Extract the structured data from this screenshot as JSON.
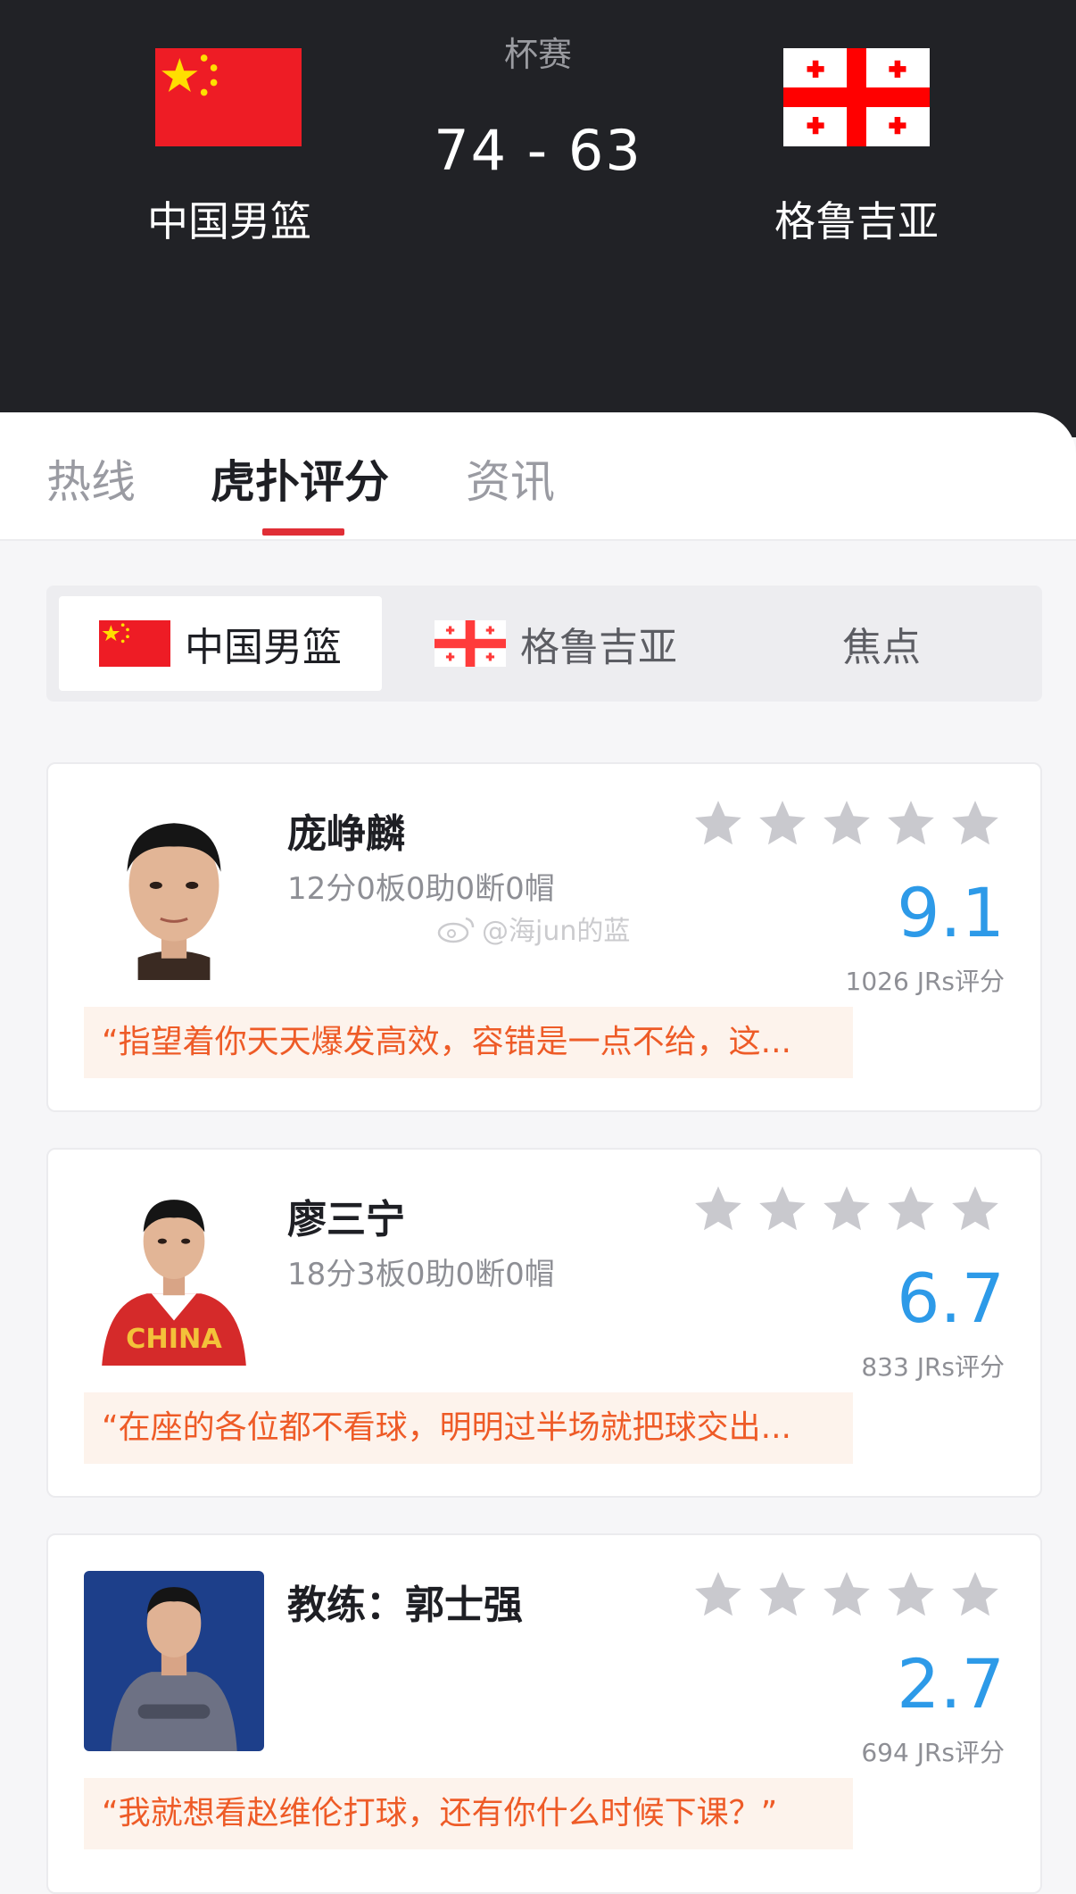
{
  "match": {
    "competition": "杯赛",
    "score": "74 - 63",
    "home_team": "中国男篮",
    "away_team": "格鲁吉亚"
  },
  "tabs": [
    "热线",
    "虎扑评分",
    "资讯"
  ],
  "active_tab": "虎扑评分",
  "segments": [
    "中国男篮",
    "格鲁吉亚",
    "焦点"
  ],
  "active_segment": "中国男篮",
  "players": [
    {
      "name": "庞峥麟",
      "stats": "12分0板0助0断0帽",
      "rating": "9.1",
      "votes": "1026 JRs评分",
      "quote": "“指望着你天天爆发高效，容错是一点不给，这..."
    },
    {
      "name": "廖三宁",
      "stats": "18分3板0助0断0帽",
      "rating": "6.7",
      "votes": "833 JRs评分",
      "quote": "“在座的各位都不看球，明明过半场就把球交出..."
    },
    {
      "name": "教练：郭士强",
      "stats": "",
      "rating": "2.7",
      "votes": "694 JRs评分",
      "quote": "“我就想看赵维伦打球，还有你什么时候下课？”"
    }
  ],
  "watermark": "@海jun的蓝",
  "jersey_text": "CHINA",
  "colors": {
    "header_bg": "#212226",
    "accent_red": "#e02e36",
    "rating_blue": "#2d9ae8",
    "quote_orange": "#ee5b27",
    "quote_bg": "#fdf3ec",
    "star_gray": "#c9c9ce"
  },
  "icons": [
    "china-flag-icon",
    "georgia-flag-icon",
    "star-icon",
    "weibo-icon"
  ]
}
